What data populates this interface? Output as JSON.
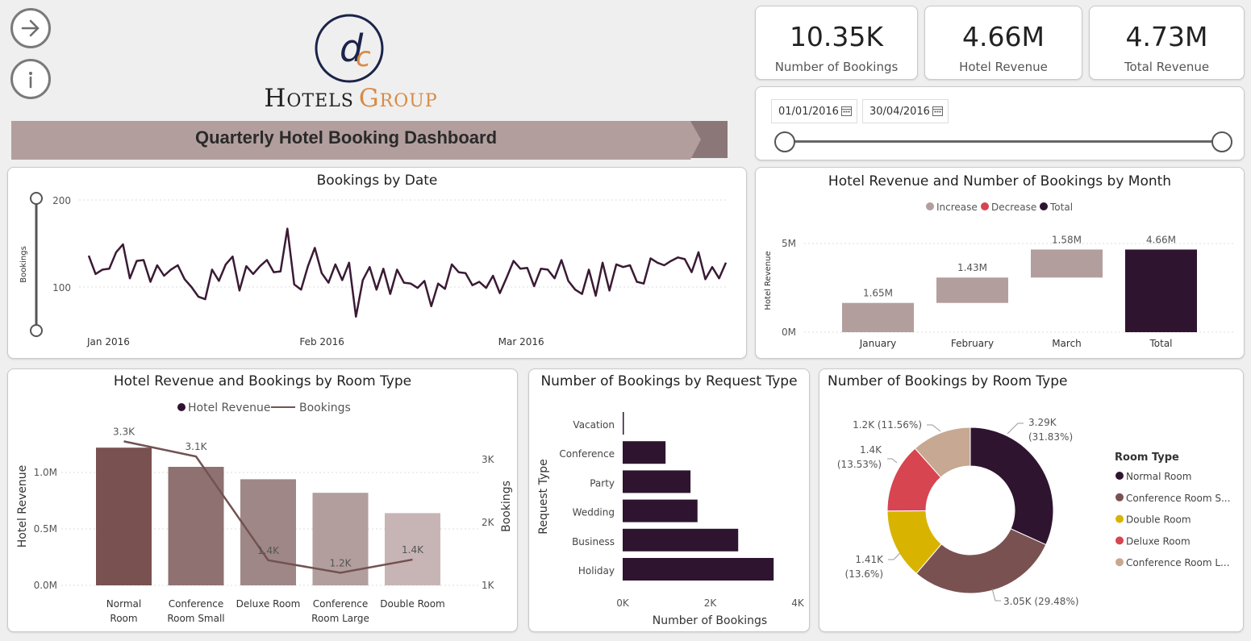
{
  "header": {
    "brand_name": "Hotels Group",
    "brand_word1": "Hotels",
    "brand_word2": "Group",
    "logo_monogram": "dc",
    "dashboard_title": "Quarterly Hotel Booking Dashboard",
    "nav_icons": [
      "arrow-right-icon",
      "info-icon"
    ]
  },
  "kpis": [
    {
      "value": "10.35K",
      "label": "Number of Bookings"
    },
    {
      "value": "4.66M",
      "label": "Hotel Revenue"
    },
    {
      "value": "4.73M",
      "label": "Total Revenue"
    }
  ],
  "date_slicer": {
    "start": "01/01/2016",
    "end": "30/04/2016",
    "icon": "calendar-icon"
  },
  "colors": {
    "dark": "#2f1430",
    "line": "#3a1a34",
    "banner": "#b39e9e",
    "banner_dark": "#8b7777",
    "increase": "#b39e9e",
    "decrease": "#d64550",
    "total": "#2f1430",
    "logo_orange": "#d98a44",
    "logo_navy": "#1b2449"
  },
  "chart_data": [
    {
      "id": "bookings_by_date",
      "type": "line",
      "title": "Bookings by Date",
      "ylabel": "Bookings",
      "xlabel": "",
      "x_tick_labels": [
        "Jan 2016",
        "Feb 2016",
        "Mar 2016"
      ],
      "y_tick_labels": [
        "100",
        "200"
      ],
      "ylim": [
        38,
        210
      ],
      "grid": true,
      "x_start": "2016-01-01",
      "values": [
        136,
        115,
        120,
        121,
        140,
        149,
        110,
        130,
        131,
        106,
        125,
        113,
        120,
        125,
        109,
        100,
        89,
        86,
        120,
        107,
        126,
        135,
        96,
        124,
        115,
        124,
        131,
        117,
        118,
        167,
        103,
        97,
        124,
        145,
        116,
        105,
        126,
        108,
        128,
        66,
        108,
        123,
        97,
        121,
        92,
        120,
        105,
        104,
        99,
        107,
        78,
        104,
        98,
        126,
        117,
        116,
        102,
        106,
        99,
        113,
        93,
        111,
        130,
        121,
        122,
        101,
        121,
        120,
        110,
        131,
        107,
        97,
        92,
        120,
        90,
        128,
        96,
        126,
        123,
        125,
        106,
        104,
        133,
        128,
        125,
        130,
        134,
        132,
        117,
        140,
        109,
        123,
        110,
        128
      ],
      "x_tick_positions": [
        0,
        31,
        60
      ]
    },
    {
      "id": "revenue_by_month",
      "type": "bar",
      "subtype": "waterfall",
      "title": "Hotel Revenue and Number of Bookings by Month",
      "ylabel": "Hotel Revenue",
      "categories": [
        "January",
        "February",
        "March",
        "Total"
      ],
      "values": [
        1.65,
        1.43,
        1.58,
        4.66
      ],
      "data_labels": [
        "1.65M",
        "1.43M",
        "1.58M",
        "4.66M"
      ],
      "legend": [
        "Increase",
        "Decrease",
        "Total"
      ],
      "legend_position": "top-center",
      "y_tick_labels": [
        "0M",
        "5M"
      ],
      "ylim": [
        0,
        5.8
      ]
    },
    {
      "id": "revenue_by_room_type",
      "type": "bar",
      "subtype": "combo-bar-line",
      "title": "Hotel Revenue and Bookings by Room Type",
      "legend": [
        "Hotel Revenue",
        "Bookings"
      ],
      "legend_position": "top-center",
      "ylabel": "Hotel Revenue",
      "y2label": "Bookings",
      "categories": [
        "Normal Room",
        "Conference Room Small",
        "Deluxe Room",
        "Conference Room Large",
        "Double Room"
      ],
      "category_lines": [
        [
          "Normal",
          "Room"
        ],
        [
          "Conference",
          "Room Small"
        ],
        [
          "Deluxe Room"
        ],
        [
          "Conference",
          "Room Large"
        ],
        [
          "Double Room"
        ]
      ],
      "series": [
        {
          "name": "Hotel Revenue",
          "values": [
            1.22,
            1.05,
            0.94,
            0.82,
            0.64
          ]
        },
        {
          "name": "Bookings",
          "values": [
            3.29,
            3.05,
            1.4,
            1.2,
            1.41
          ]
        }
      ],
      "line_labels": [
        "3.3K",
        "3.1K",
        "1.4K",
        "1.2K",
        "1.4K"
      ],
      "bar_colors": [
        "#7a5151",
        "#8f7171",
        "#a08787",
        "#b39e9e",
        "#c7b5b5"
      ],
      "line_color": "#735252",
      "y_tick_labels": [
        "0.0M",
        "0.5M",
        "1.0M"
      ],
      "y2_tick_labels": [
        "1K",
        "2K",
        "3K"
      ],
      "ylim": [
        0,
        1.5
      ],
      "y2lim": [
        1,
        3
      ]
    },
    {
      "id": "bookings_by_request_type",
      "type": "bar",
      "subtype": "horizontal",
      "title": "Number of Bookings by Request Type",
      "xlabel": "Number of Bookings",
      "ylabel": "Request Type",
      "categories": [
        "Vacation",
        "Conference",
        "Party",
        "Wedding",
        "Business",
        "Holiday"
      ],
      "values": [
        20,
        980,
        1550,
        1710,
        2640,
        3450
      ],
      "x_tick_labels": [
        "0K",
        "2K",
        "4K"
      ],
      "xlim": [
        0,
        4000
      ]
    },
    {
      "id": "bookings_by_room_type",
      "type": "pie",
      "subtype": "donut",
      "title": "Number of Bookings by Room Type",
      "legend_title": "Room Type",
      "legend_position": "right",
      "categories": [
        "Normal Room",
        "Conference Room S...",
        "Double Room",
        "Deluxe Room",
        "Conference Room L..."
      ],
      "values": [
        3.29,
        3.05,
        1.41,
        1.4,
        1.2
      ],
      "percents": [
        31.83,
        29.48,
        13.6,
        13.53,
        11.56
      ],
      "colors": [
        "#2f1430",
        "#7a5151",
        "#d8b400",
        "#d64550",
        "#c7a892"
      ],
      "slice_labels": [
        [
          "3.29K",
          "(31.83%)"
        ],
        [
          "3.05K (29.48%)"
        ],
        [
          "1.41K",
          "(13.6%)"
        ],
        [
          "1.4K",
          "(13.53%)"
        ],
        [
          "1.2K (11.56%)"
        ]
      ]
    }
  ]
}
